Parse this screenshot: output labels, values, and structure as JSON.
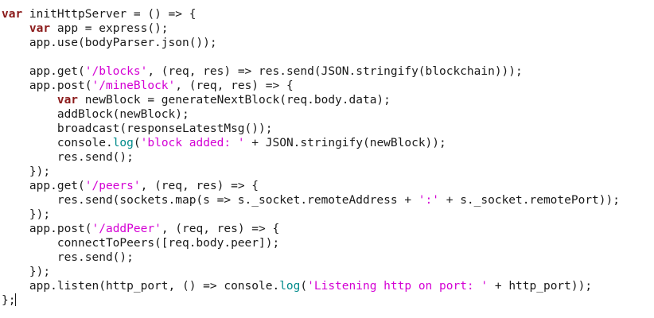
{
  "editor": {
    "colors": {
      "background": "#ffffff",
      "text": "#1a1a1a",
      "keyword": "#8b1a1a",
      "string": "#d400d4",
      "builtin": "#008b8b"
    },
    "lines": [
      [
        [
          "kw",
          "var"
        ],
        [
          "p",
          " initHttpServer = () => {"
        ]
      ],
      [
        [
          "p",
          "    "
        ],
        [
          "kw",
          "var"
        ],
        [
          "p",
          " app = express();"
        ]
      ],
      [
        [
          "p",
          "    app.use(bodyParser.json());"
        ]
      ],
      [
        [
          "p",
          ""
        ]
      ],
      [
        [
          "p",
          "    app.get("
        ],
        [
          "s",
          "'/blocks'"
        ],
        [
          "p",
          ", (req, res) => res.send(JSON.stringify(blockchain)));"
        ]
      ],
      [
        [
          "p",
          "    app.post("
        ],
        [
          "s",
          "'/mineBlock'"
        ],
        [
          "p",
          ", (req, res) => {"
        ]
      ],
      [
        [
          "p",
          "        "
        ],
        [
          "kw",
          "var"
        ],
        [
          "p",
          " newBlock = generateNextBlock(req.body.data);"
        ]
      ],
      [
        [
          "p",
          "        addBlock(newBlock);"
        ]
      ],
      [
        [
          "p",
          "        broadcast(responseLatestMsg());"
        ]
      ],
      [
        [
          "p",
          "        console."
        ],
        [
          "f",
          "log"
        ],
        [
          "p",
          "("
        ],
        [
          "s",
          "'block added: '"
        ],
        [
          "p",
          " + JSON.stringify(newBlock));"
        ]
      ],
      [
        [
          "p",
          "        res.send();"
        ]
      ],
      [
        [
          "p",
          "    });"
        ]
      ],
      [
        [
          "p",
          "    app.get("
        ],
        [
          "s",
          "'/peers'"
        ],
        [
          "p",
          ", (req, res) => {"
        ]
      ],
      [
        [
          "p",
          "        res.send(sockets.map(s => s._socket.remoteAddress + "
        ],
        [
          "s",
          "':'"
        ],
        [
          "p",
          " + s._socket.remotePort));"
        ]
      ],
      [
        [
          "p",
          "    });"
        ]
      ],
      [
        [
          "p",
          "    app.post("
        ],
        [
          "s",
          "'/addPeer'"
        ],
        [
          "p",
          ", (req, res) => {"
        ]
      ],
      [
        [
          "p",
          "        connectToPeers([req.body.peer]);"
        ]
      ],
      [
        [
          "p",
          "        res.send();"
        ]
      ],
      [
        [
          "p",
          "    });"
        ]
      ],
      [
        [
          "p",
          "    app.listen(http_port, () => console."
        ],
        [
          "f",
          "log"
        ],
        [
          "p",
          "("
        ],
        [
          "s",
          "'Listening http on port: '"
        ],
        [
          "p",
          " + http_port));"
        ]
      ],
      [
        [
          "p",
          "};"
        ]
      ]
    ]
  }
}
